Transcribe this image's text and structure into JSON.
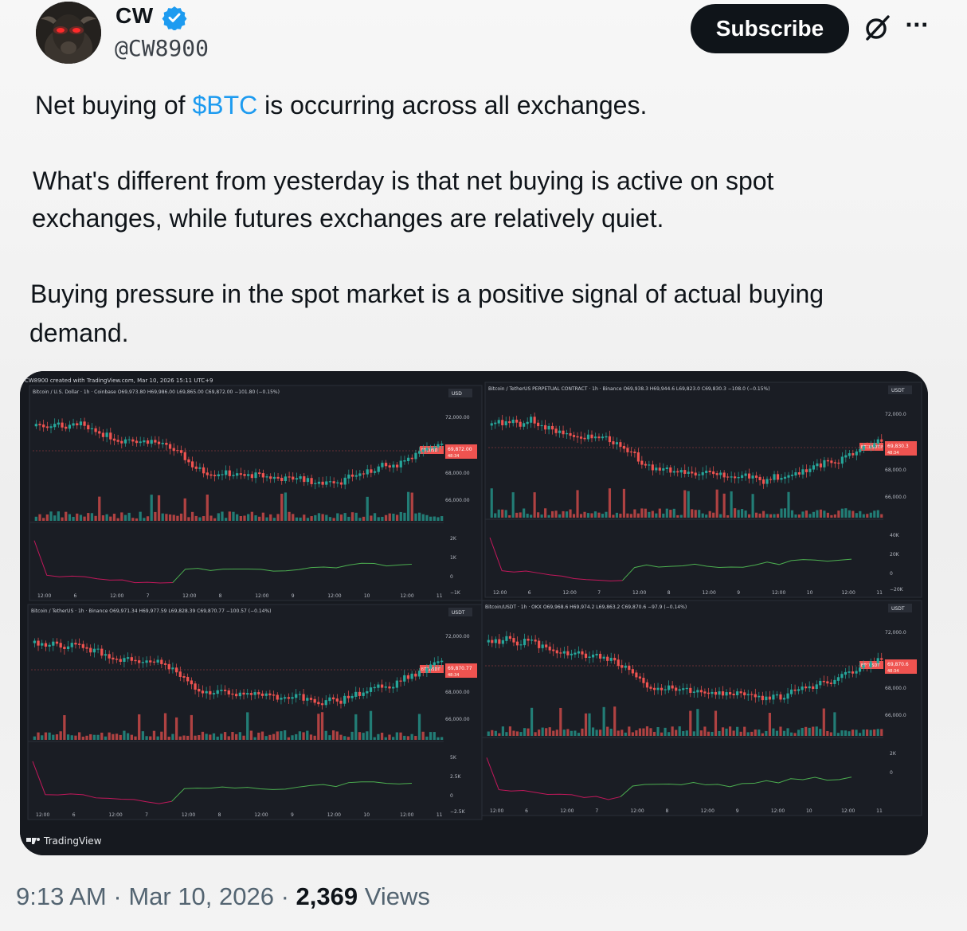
{
  "author": {
    "display_name": "CW",
    "handle": "@CW8900",
    "verified": true,
    "avatar_icon": "bull-avatar-icon"
  },
  "header": {
    "subscribe_label": "Subscribe",
    "grok_icon": "grok-icon",
    "more_icon": "more-icon",
    "more_glyph": "···"
  },
  "tweet": {
    "line1_prefix": "Net buying of ",
    "cashtag": "$BTC",
    "line1_suffix": " is occurring across all exchanges.",
    "para2_line1": "What's different from yesterday is that net buying is active on spot",
    "para2_line2": "exchanges, while futures exchanges are relatively quiet.",
    "para3_line1": "Buying pressure in the spot market is a positive signal of actual buying",
    "para3_line2": "demand."
  },
  "media": {
    "watermark": "CW8900 created with TradingView.com, Mar 10, 2026 15:11 UTC+9",
    "brand": "TradingView",
    "brand_icon": "tradingview-logo-icon",
    "time_labels": [
      "12:00",
      "6",
      "12:00",
      "7",
      "12:00",
      "8",
      "12:00",
      "9",
      "12:00",
      "10",
      "12:00",
      "11"
    ],
    "panels": [
      {
        "title": "Bitcoin / U.S. Dollar · 1h · Coinbase",
        "ohlc": "O69,973.80 H69,986.00 L69,865.00 C69,872.00 −101.80 (−0.15%)",
        "currency": "USD",
        "ticker": "BTCUSD",
        "last_price": "69,872.00",
        "countdown": "48:34",
        "price_ticks": [
          "72,000.00",
          "68,000.00",
          "66,000.00"
        ],
        "cvd_ticks": [
          "2K",
          "1K",
          "0",
          "−1K"
        ]
      },
      {
        "title": "Bitcoin / TetherUS PERPETUAL CONTRACT · 1h · Binance",
        "ohlc": "O69,938.3 H69,944.6 L69,823.0 C69,830.3 −108.0 (−0.15%)",
        "currency": "USDT",
        "ticker": "BTCUSDT.P",
        "last_price": "69,830.3",
        "countdown": "48:34",
        "price_ticks": [
          "72,000.0",
          "68,000.0",
          "66,000.0"
        ],
        "cvd_ticks": [
          "40K",
          "20K",
          "0",
          "−20K"
        ]
      },
      {
        "title": "Bitcoin / TetherUS · 1h · Binance",
        "ohlc": "O69,971.34 H69,977.59 L69,828.39 C69,870.77 −100.57 (−0.14%)",
        "currency": "USDT",
        "ticker": "BTCUSDT",
        "last_price": "69,870.77",
        "countdown": "48:34",
        "price_ticks": [
          "72,000.00",
          "68,000.00",
          "66,000.00"
        ],
        "cvd_ticks": [
          "5K",
          "2.5K",
          "0",
          "−2.5K"
        ]
      },
      {
        "title": "Bitcoin/USDT · 1h · OKX",
        "ohlc": "O69,968.6 H69,974.2 L69,863.2 C69,870.6 −97.9 (−0.14%)",
        "currency": "USDT",
        "ticker": "BTCUSDT",
        "last_price": "69,870.6",
        "countdown": "48:34",
        "price_ticks": [
          "72,000.0",
          "68,000.0",
          "66,000.0"
        ],
        "cvd_ticks": [
          "2K",
          "0"
        ]
      }
    ],
    "colors": {
      "up": "#26a69a",
      "down": "#ef5350",
      "cvd_positive": "#4caf50",
      "cvd_negative": "#c2185b",
      "background": "#16191f"
    }
  },
  "footer": {
    "time": "9:13 AM",
    "separator": " · ",
    "date": "Mar 10, 2026",
    "views_count": "2,369",
    "views_label": " Views"
  }
}
